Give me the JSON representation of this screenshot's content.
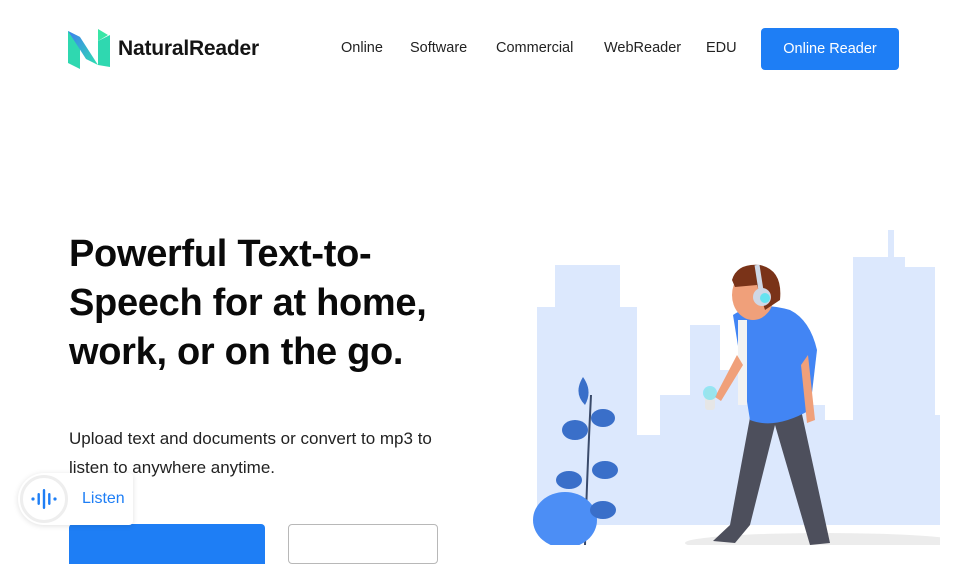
{
  "brand": {
    "name": "NaturalReader",
    "accent": "#1e7ef5"
  },
  "nav": {
    "items": [
      {
        "label": "Online"
      },
      {
        "label": "Software"
      },
      {
        "label": "Commercial"
      },
      {
        "label": "WebReader"
      },
      {
        "label": "EDU"
      }
    ],
    "cta_label": "Online Reader"
  },
  "hero": {
    "title_lines": [
      "Powerful Text-to-",
      "Speech for at home,",
      "work, or on the go."
    ],
    "subtitle_lines": [
      "Upload text and documents or convert to mp3 to",
      "listen to anywhere anytime."
    ]
  },
  "listen_widget": {
    "label": "Listen",
    "icon": "sound-wave-icon"
  },
  "illustration": {
    "description": "person-walking-with-headphones-city-icon"
  }
}
